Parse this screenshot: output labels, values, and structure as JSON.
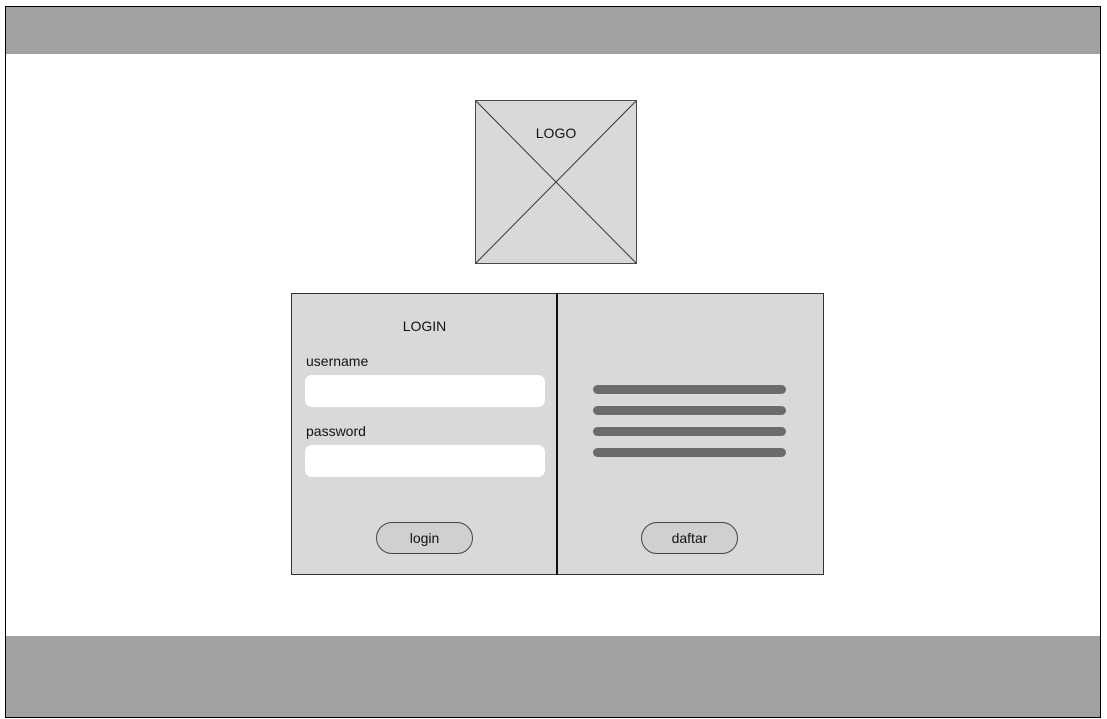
{
  "logo": {
    "label": "LOGO"
  },
  "login_panel": {
    "title": "LOGIN",
    "username_label": "username",
    "username_value": "",
    "password_label": "password",
    "password_value": "",
    "login_button_label": "login"
  },
  "register_panel": {
    "text_line_count": 4,
    "daftar_button_label": "daftar"
  },
  "colors": {
    "bar": "#a1a1a1",
    "panel": "#d9d9d9",
    "text_line": "#6b6b6b"
  }
}
